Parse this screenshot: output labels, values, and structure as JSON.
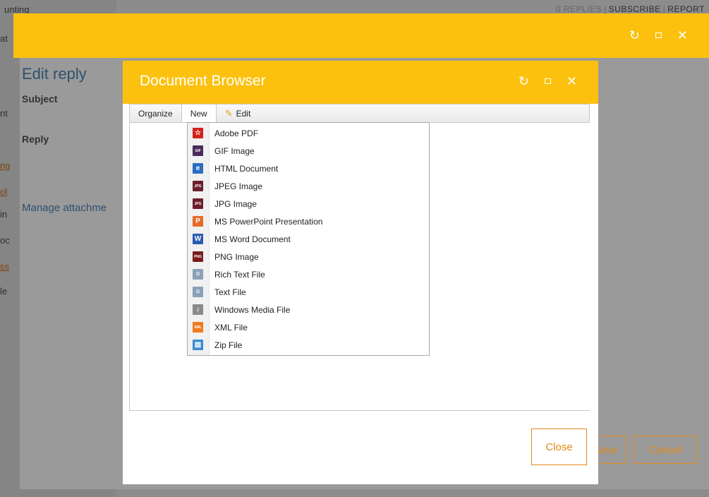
{
  "background": {
    "top_left_text": "unting",
    "top_right": {
      "faded": "0 REPLIES",
      "subscribe": "SUBSCRIBE",
      "report": "REPORT"
    },
    "side_fragments": [
      "at",
      "nt",
      "",
      "ng",
      "ol",
      "in",
      "oc",
      "ss",
      "le"
    ]
  },
  "outer_dialog": {
    "title": "Edit reply",
    "subject_label": "Subject",
    "reply_label": "Reply",
    "manage_attachments": "Manage attachme",
    "save_label": "Save",
    "cancel_label": "Cancel"
  },
  "document_browser": {
    "title": "Document Browser",
    "toolbar": {
      "organize": "Organize",
      "new": "New",
      "edit": "Edit"
    },
    "close_label": "Close",
    "new_menu": [
      {
        "label": "Adobe PDF",
        "icon": "pdf-icon",
        "color": "#d2231b"
      },
      {
        "label": "GIF Image",
        "icon": "gif-icon",
        "color": "#4a2a5a"
      },
      {
        "label": "HTML Document",
        "icon": "html-icon",
        "color": "#2a6fbf"
      },
      {
        "label": "JPEG Image",
        "icon": "jpeg-icon",
        "color": "#6b1f2a"
      },
      {
        "label": "JPG Image",
        "icon": "jpg-icon",
        "color": "#6b1f2a"
      },
      {
        "label": "MS PowerPoint Presentation",
        "icon": "powerpoint-icon",
        "color": "#e86a2a"
      },
      {
        "label": "MS Word Document",
        "icon": "word-icon",
        "color": "#2a5bb0"
      },
      {
        "label": "PNG Image",
        "icon": "png-icon",
        "color": "#7a1c1c"
      },
      {
        "label": "Rich Text File",
        "icon": "rtf-icon",
        "color": "#8aa0b8"
      },
      {
        "label": "Text File",
        "icon": "txt-icon",
        "color": "#8aa0b8"
      },
      {
        "label": "Windows Media File",
        "icon": "media-icon",
        "color": "#8a8a8a"
      },
      {
        "label": "XML File",
        "icon": "xml-icon",
        "color": "#f07a20"
      },
      {
        "label": "Zip File",
        "icon": "zip-icon",
        "color": "#3a8ad0"
      }
    ]
  },
  "colors": {
    "header_yellow": "#fcc10e",
    "accent_orange": "#e08a17",
    "title_blue": "#2f4f6f"
  }
}
